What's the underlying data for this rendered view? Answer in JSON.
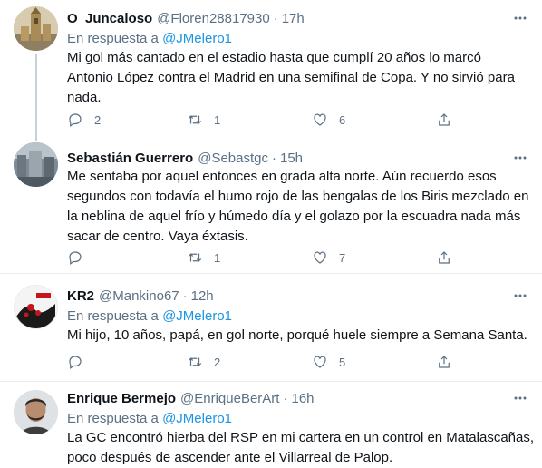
{
  "reply_prefix": "En respuesta a",
  "tweets": [
    {
      "name": "O_Juncaloso",
      "handle": "@Floren28817930",
      "time": "17h",
      "reply_to": "@JMelero1",
      "text_lines": [
        "Mi gol más cantado en el estadio hasta que cumplí 20 años lo marcó",
        "Antonio López contra el Madrid en una semifinal de Copa. Y no sirvió para",
        "nada."
      ],
      "replies": "2",
      "retweets": "1",
      "likes": "6"
    },
    {
      "name": "Sebastián Guerrero",
      "handle": "@Sebastgc",
      "time": "15h",
      "reply_to": "",
      "text_lines": [
        "Me sentaba por aquel entonces en grada alta norte. Aún recuerdo esos",
        "segundos con todavía el humo rojo de las bengalas de los Biris mezclado en",
        "la neblina de aquel frío y húmedo día y el golazo por la escuadra nada más",
        "sacar de centro. Vaya éxtasis."
      ],
      "replies": "",
      "retweets": "1",
      "likes": "7"
    },
    {
      "name": "KR2",
      "handle": "@Mankino67",
      "time": "12h",
      "reply_to": "@JMelero1",
      "text_lines": [
        "Mi hijo, 10 años, papá, en gol norte,  porqué huele siempre a Semana Santa."
      ],
      "replies": "",
      "retweets": "2",
      "likes": "5"
    },
    {
      "name": "Enrique Bermejo",
      "handle": "@EnriqueBerArt",
      "time": "16h",
      "reply_to": "@JMelero1",
      "text_lines": [
        "La GC encontró hierba del RSP en mi cartera en un control en Matalascañas,",
        "poco después de ascender ante el Villarreal de Palop."
      ],
      "replies": "",
      "retweets": "",
      "likes": ""
    }
  ],
  "icons": {
    "reply": "reply-icon",
    "retweet": "retweet-icon",
    "like": "like-icon",
    "share": "share-icon",
    "more": "more-icon"
  },
  "colors": {
    "link": "#1b95e0",
    "muted": "#5b7083",
    "divider": "#e6ecf0",
    "text": "#0f1419"
  }
}
